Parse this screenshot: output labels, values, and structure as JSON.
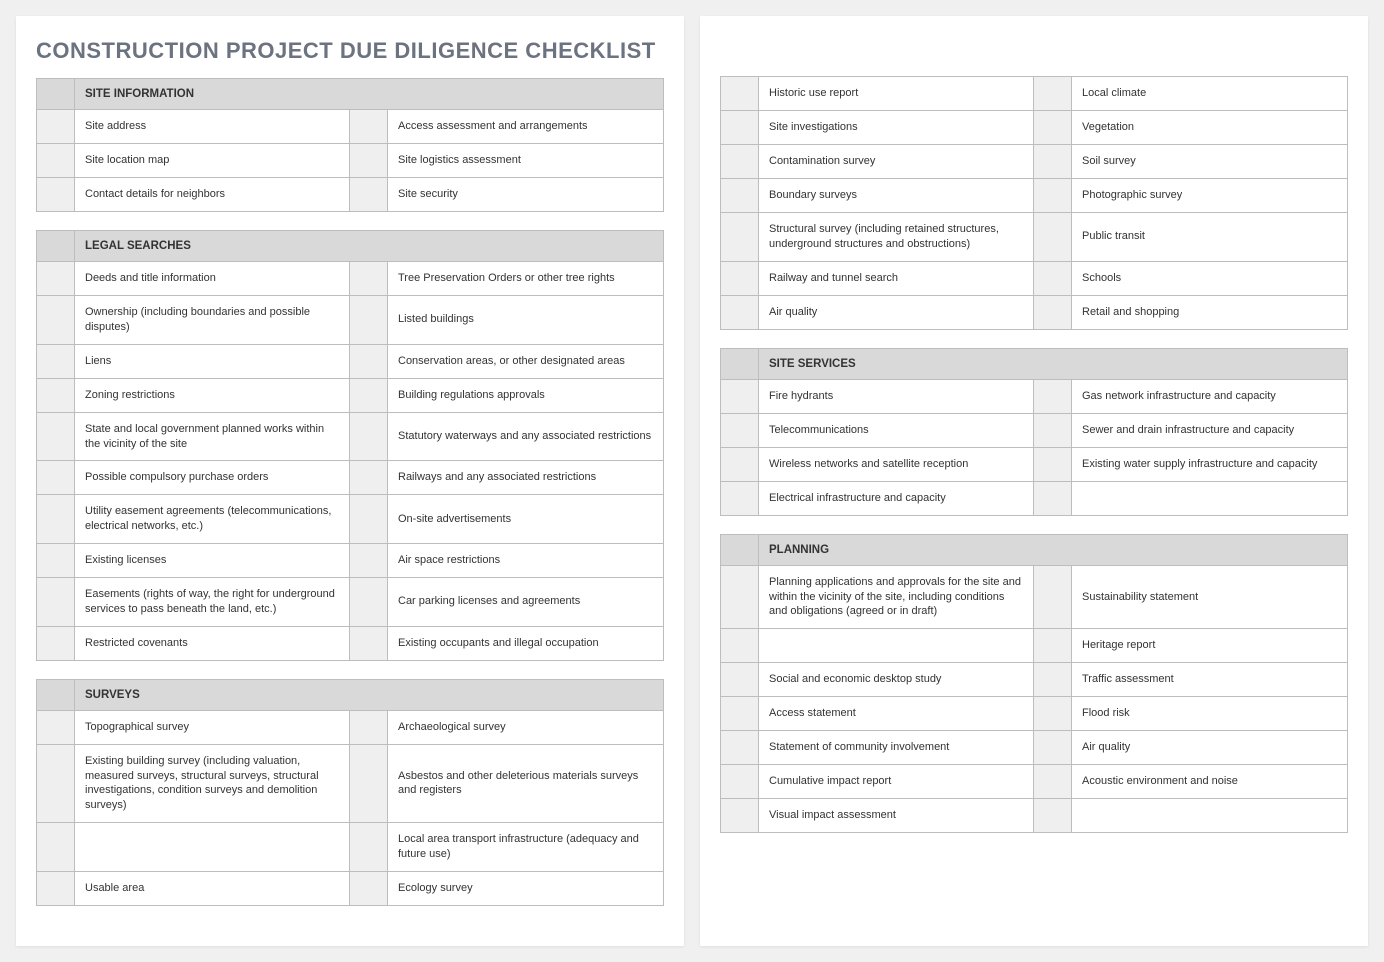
{
  "doc_title": "CONSTRUCTION PROJECT DUE DILIGENCE CHECKLIST",
  "sections": {
    "site_info": {
      "header": "SITE INFORMATION",
      "rows": [
        [
          "Site address",
          "Access assessment and arrangements"
        ],
        [
          "Site location map",
          "Site logistics assessment"
        ],
        [
          "Contact details for neighbors",
          "Site security"
        ]
      ]
    },
    "legal": {
      "header": "LEGAL SEARCHES",
      "rows": [
        [
          "Deeds and title information",
          "Tree Preservation Orders or other tree rights"
        ],
        [
          "Ownership (including boundaries and possible disputes)",
          "Listed buildings"
        ],
        [
          "Liens",
          "Conservation areas, or other designated areas"
        ],
        [
          "Zoning restrictions",
          "Building regulations approvals"
        ],
        [
          "State and local government planned works within the vicinity of the site",
          "Statutory waterways and any associated restrictions"
        ],
        [
          "Possible compulsory purchase orders",
          "Railways and any associated restrictions"
        ],
        [
          "Utility easement agreements (telecommunications, electrical networks, etc.)",
          "On-site advertisements"
        ],
        [
          "Existing licenses",
          "Air space restrictions"
        ],
        [
          "Easements (rights of way, the right for underground services to pass beneath the land, etc.)",
          "Car parking licenses and agreements"
        ],
        [
          "Restricted covenants",
          "Existing occupants and illegal occupation"
        ]
      ]
    },
    "surveys": {
      "header": "SURVEYS",
      "rows_p1": [
        [
          "Topographical survey",
          "Archaeological survey"
        ],
        [
          "Existing building survey (including valuation, measured surveys, structural surveys, structural investigations, condition surveys and demolition surveys)",
          "Asbestos and other deleterious materials surveys and registers"
        ],
        [
          "",
          "Local area transport infrastructure (adequacy and future use)"
        ],
        [
          "Usable area",
          "Ecology survey"
        ]
      ],
      "rows_p2": [
        [
          "Historic use report",
          "Local climate"
        ],
        [
          "Site investigations",
          "Vegetation"
        ],
        [
          "Contamination survey",
          "Soil survey"
        ],
        [
          "Boundary surveys",
          "Photographic survey"
        ],
        [
          "Structural survey (including retained structures, underground structures and obstructions)",
          "Public transit"
        ],
        [
          "Railway and tunnel search",
          "Schools"
        ],
        [
          "Air quality",
          "Retail and shopping"
        ]
      ]
    },
    "services": {
      "header": "SITE SERVICES",
      "rows": [
        [
          "Fire hydrants",
          "Gas network infrastructure and capacity"
        ],
        [
          "Telecommunications",
          "Sewer and drain infrastructure and capacity"
        ],
        [
          "Wireless networks and satellite reception",
          "Existing water supply infrastructure and capacity"
        ],
        [
          "Electrical infrastructure and capacity",
          ""
        ]
      ]
    },
    "planning": {
      "header": "PLANNING",
      "rows": [
        [
          "Planning applications and approvals for the site and within the vicinity of the site, including conditions and obligations (agreed or in draft)",
          "Sustainability statement"
        ],
        [
          "",
          "Heritage report"
        ],
        [
          "Social and economic desktop study",
          "Traffic assessment"
        ],
        [
          "Access statement",
          "Flood risk"
        ],
        [
          "Statement of community involvement",
          "Air quality"
        ],
        [
          "Cumulative impact report",
          "Acoustic environment and noise"
        ],
        [
          "Visual impact assessment",
          ""
        ]
      ]
    }
  }
}
